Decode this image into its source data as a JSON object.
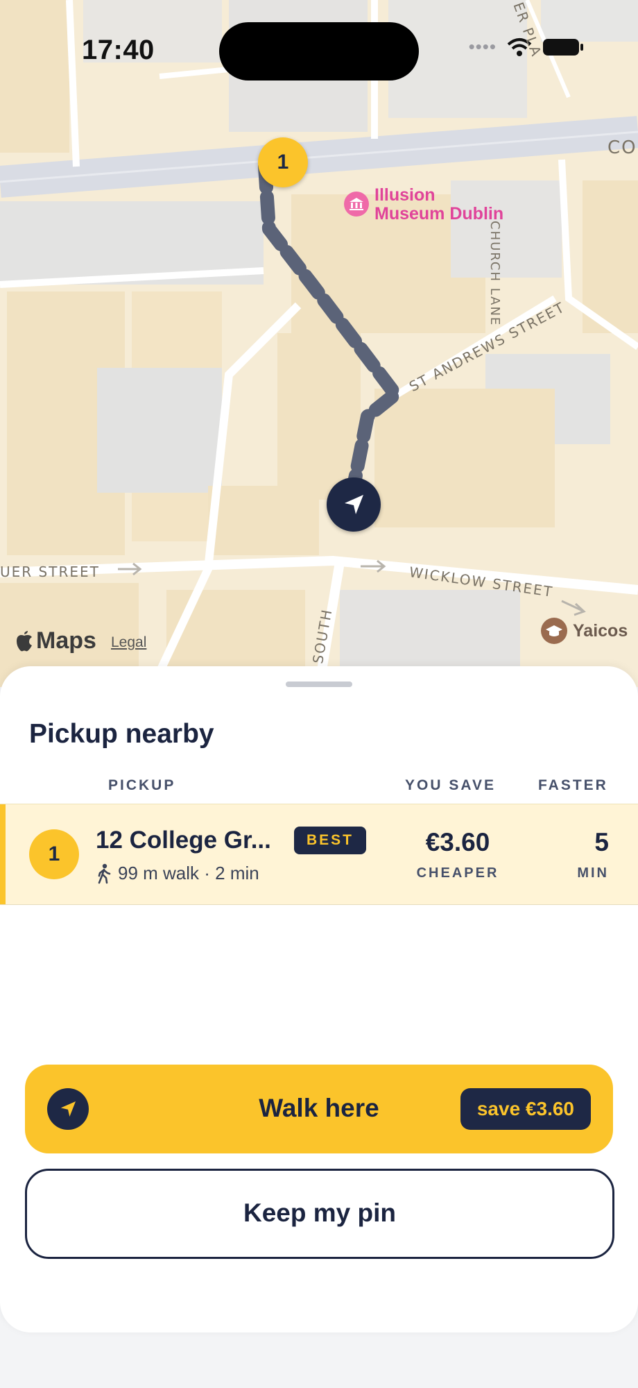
{
  "status_bar": {
    "time": "17:40"
  },
  "map": {
    "poi_museum": [
      "Illusion",
      "Museum Dublin"
    ],
    "poi_yaicos": "Yaicos",
    "streets": {
      "co": "CO",
      "church_lane": "CHURCH LANE",
      "st_andrews": "ST ANDREWS STREET",
      "uer": "UER STREET",
      "wicklow": "WICKLOW STREET",
      "south": "SOUTH",
      "er_pla": "ER PLA"
    },
    "pickup_marker": "1",
    "attribution": "Maps",
    "legal": "Legal"
  },
  "sheet": {
    "title": "Pickup nearby",
    "columns": {
      "pickup": "PICKUP",
      "you_save": "YOU SAVE",
      "faster": "FASTER"
    },
    "rows": [
      {
        "number": "1",
        "name": "12 College Gr...",
        "badge": "BEST",
        "walk": "99 m walk · 2 min",
        "save_value": "€3.60",
        "save_sub": "CHEAPER",
        "faster_value": "5",
        "faster_sub": "MIN"
      }
    ],
    "primary_button": {
      "label": "Walk here",
      "pill": "save €3.60"
    },
    "secondary_button": {
      "label": "Keep my pin"
    }
  },
  "colors": {
    "accent": "#fbc42b",
    "navy": "#1e2845",
    "poi_pink": "#e0449a",
    "map_bg": "#f6ecd6"
  }
}
